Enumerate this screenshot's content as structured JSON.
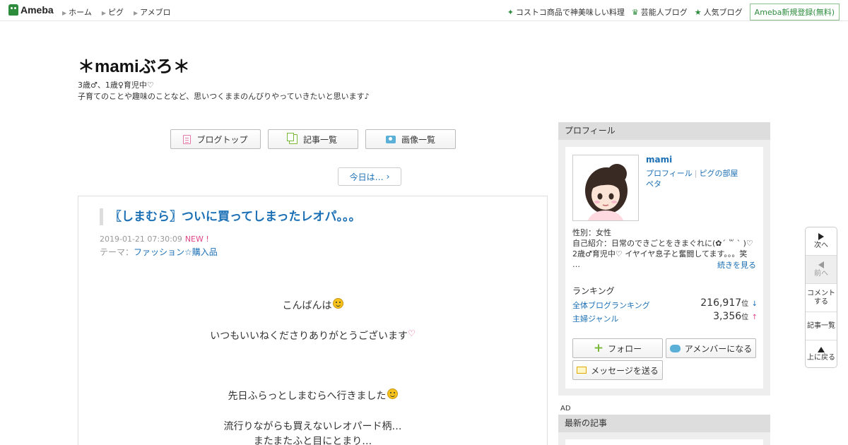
{
  "topbar": {
    "logo": "Ameba",
    "nav": [
      "ホーム",
      "ピグ",
      "アメブロ"
    ],
    "right_links": [
      {
        "label": "コストコ商品で神美味しい料理",
        "icon": "sparkle-icon"
      },
      {
        "label": "芸能人ブログ",
        "icon": "crown-icon"
      },
      {
        "label": "人気ブログ",
        "icon": "star-icon"
      }
    ],
    "register": "Ameba新規登録(無料)"
  },
  "blog": {
    "title": "＊mamiぶろ＊",
    "desc1": "3歳♂、1歳♀育児中♡",
    "desc2": "子育てのことや趣味のことなど、思いつくままのんびりやっていきたいと思います♪"
  },
  "nav_buttons": {
    "top": "ブログトップ",
    "list": "記事一覧",
    "images": "画像一覧"
  },
  "today": "今日は…",
  "article": {
    "title": "〖しまむら〗ついに買ってしまったレオパ。。。",
    "date": "2019-01-21 07:30:09",
    "new_badge": "NEW !",
    "theme_label": "テーマ：",
    "theme": "ファッション☆購入品",
    "lines": {
      "l1": "こんばんは",
      "l2": "いつもいいねくださりありがとうございます",
      "l3": "先日ふらっとしまむらへ行きました",
      "l4": "流行りながらも買えないレオパード柄…",
      "l5": "またまたふと目にとまり…"
    }
  },
  "profile": {
    "header": "プロフィール",
    "name": "mami",
    "link_profile": "プロフィール",
    "link_pig_room": "ピグの部屋",
    "link_peta": "ペタ",
    "gender": "性別：女性",
    "intro_line1": "自己紹介：日常のできごとをきまぐれに(✿´ ꒳ ` )♡",
    "intro_line2": "2歳♂育児中♡ イヤイヤ息子と奮闘してます。。。笑",
    "intro_line3": "…",
    "more": "続きを見る",
    "ranking_label": "ランキング",
    "rank_all_label": "全体ブログランキング",
    "rank_all_value": "216,917",
    "rank_genre_label": "主婦ジャンル",
    "rank_genre_value": "3,356",
    "rank_unit": "位",
    "arrow_down": "↓",
    "arrow_up": "↑",
    "follow": "フォロー",
    "member": "アメンバーになる",
    "message": "メッセージを送る"
  },
  "ad": "AD",
  "latest_header": "最新の記事",
  "floatnav": {
    "next": "次へ",
    "prev": "前へ",
    "comment1": "コメント",
    "comment2": "する",
    "list": "記事一覧",
    "top": "上に戻る"
  },
  "colors": {
    "link": "#1a6fb5",
    "ameba_green": "#2d8c3c",
    "new_pink": "#e0458a"
  }
}
